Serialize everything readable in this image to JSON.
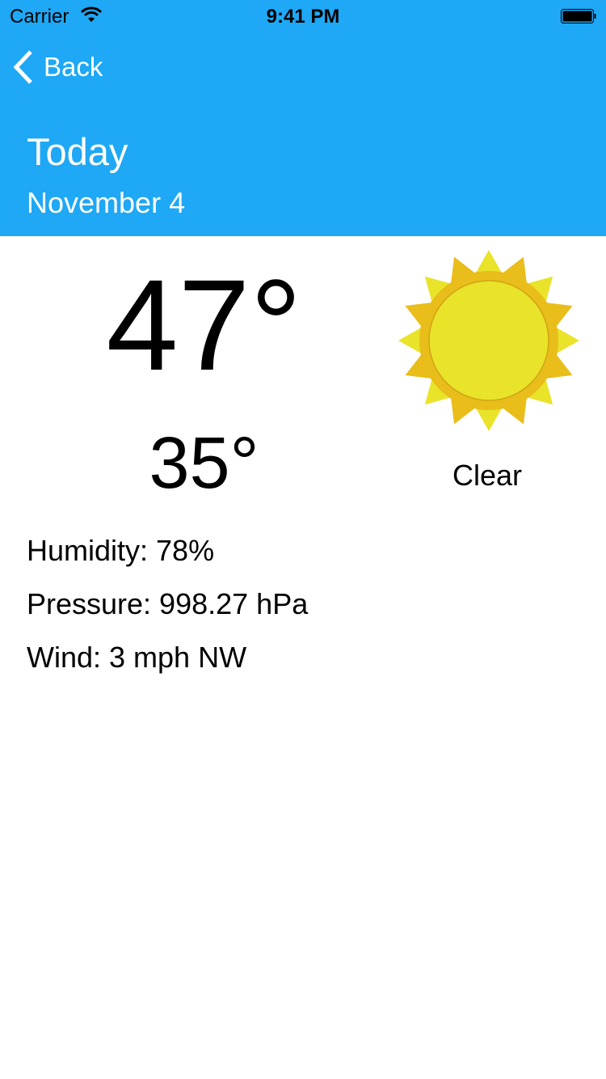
{
  "status_bar": {
    "carrier": "Carrier",
    "time": "9:41 PM"
  },
  "nav": {
    "back_label": "Back"
  },
  "header": {
    "title": "Today",
    "date": "November 4"
  },
  "weather": {
    "high": "47°",
    "low": "35°",
    "condition": "Clear",
    "icon": "sun-icon",
    "humidity": "Humidity: 78%",
    "pressure": "Pressure: 998.27 hPa",
    "wind": "Wind: 3 mph NW"
  },
  "colors": {
    "header": "#1ea8f5",
    "sun_light": "#e9e32a",
    "sun_dark": "#e9bd1a"
  }
}
